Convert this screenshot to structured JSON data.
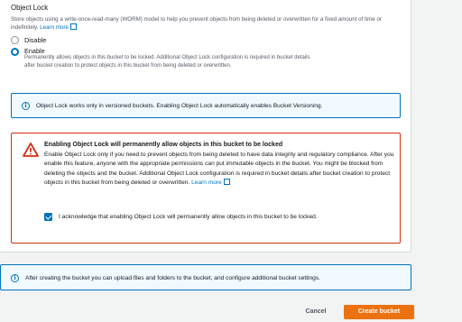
{
  "object_lock": {
    "title": "Object Lock",
    "description": "Store objects using a write-once-read-many (WORM) model to help you prevent objects from being deleted or overwritten for a fixed amount of time or indefinitely.",
    "learn_more": "Learn more",
    "options": [
      {
        "label": "Disable",
        "selected": false
      },
      {
        "label": "Enable",
        "selected": true,
        "description": "Permanently allows objects in this bucket to be locked. Additional Object Lock configuration is required in bucket details after bucket creation to protect objects in this bucket from being deleted or overwritten."
      }
    ]
  },
  "info_versioning": "Object Lock works only in versioned buckets. Enabling Object Lock automatically enables Bucket Versioning.",
  "warning": {
    "title": "Enabling Object Lock will permanently allow objects in this bucket to be locked",
    "body": "Enable Object Lock only if you need to prevent objects from being deleted to have data integrity and regulatory compliance. After you enable this feature, anyone with the appropriate permissions can put immutable objects in the bucket. You might be blocked from deleting the objects and the bucket. Additional Object Lock configuration is required in bucket details after bucket creation to protect objects in this bucket from being deleted or overwritten.",
    "learn_more": "Learn more",
    "acknowledge": "I acknowledge that enabling Object Lock will permanently allow objects in this bucket to be locked.",
    "acknowledged": true
  },
  "info_after_create": "After creating the bucket you can upload files and folders to the bucket, and configure additional bucket settings.",
  "footer": {
    "cancel": "Cancel",
    "create": "Create bucket"
  },
  "colors": {
    "accent": "#0073bb",
    "warning": "#d13212",
    "primary_button": "#ec7211",
    "info_background": "#f1faff"
  }
}
